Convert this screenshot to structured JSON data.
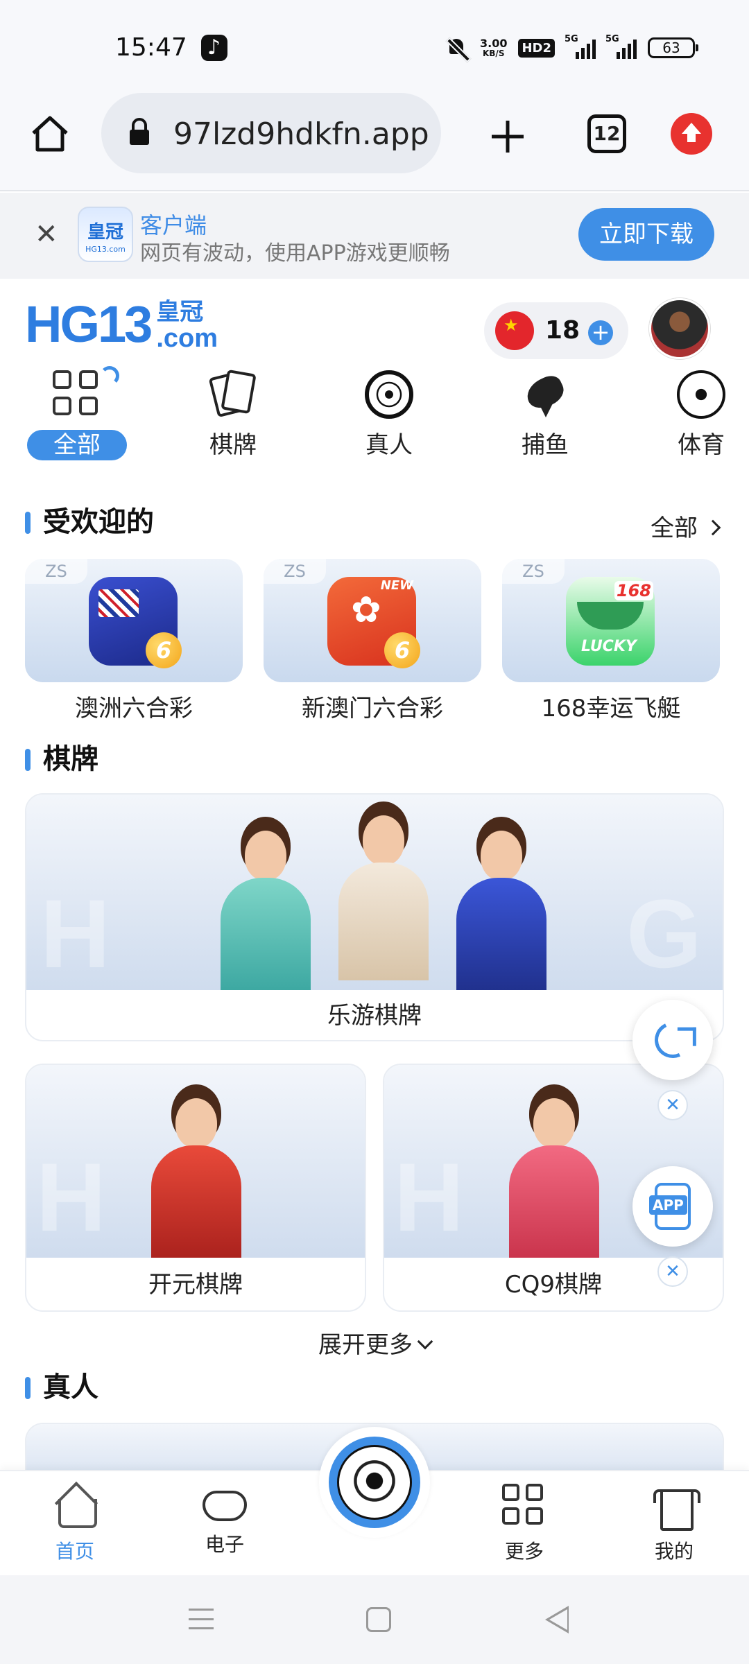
{
  "status_bar": {
    "time": "15:47",
    "net_speed_value": "3.00",
    "net_speed_unit": "KB/S",
    "hd_label": "HD2",
    "signal1_label": "5G",
    "signal2_label": "5G",
    "battery": "63"
  },
  "browser": {
    "url": "97lzd9hdkfn.app",
    "tab_count": "12"
  },
  "app_banner": {
    "logo_text": "皇冠",
    "logo_sub": "HG13.com",
    "title": "客户端",
    "subtitle": "网页有波动，使用APP游戏更顺畅",
    "download_label": "立即下载"
  },
  "header": {
    "logo_main": "HG13",
    "logo_cn": "皇冠",
    "logo_com": ".com",
    "balance": "18",
    "add_label": "+"
  },
  "categories": [
    {
      "label": "全部",
      "icon": "grid-icon",
      "active": true
    },
    {
      "label": "棋牌",
      "icon": "cards-icon"
    },
    {
      "label": "真人",
      "icon": "roulette-icon"
    },
    {
      "label": "捕鱼",
      "icon": "fish-icon"
    },
    {
      "label": "体育",
      "icon": "soccer-ball-icon"
    }
  ],
  "popular": {
    "title": "受欢迎的",
    "more_label": "全部",
    "items": [
      {
        "tag": "ZS",
        "name": "澳洲六合彩",
        "badge": "6"
      },
      {
        "tag": "ZS",
        "name": "新澳门六合彩",
        "badge": "6",
        "corner": "NEW"
      },
      {
        "tag": "ZS",
        "name": "168幸运飞艇",
        "corner": "168",
        "mark": "LUCKY"
      }
    ]
  },
  "chess": {
    "title": "棋牌",
    "featured": "乐游棋牌",
    "items": [
      "开元棋牌",
      "CQ9棋牌"
    ],
    "expand_label": "展开更多"
  },
  "live": {
    "title": "真人"
  },
  "floating": {
    "app_label": "APP",
    "close_label": "✕"
  },
  "bottom_nav": [
    {
      "label": "首页",
      "icon": "home-icon",
      "active": true
    },
    {
      "label": "电子",
      "icon": "gamepad-icon"
    },
    {
      "label": "",
      "icon": "soccer-ball-icon"
    },
    {
      "label": "更多",
      "icon": "grid-icon"
    },
    {
      "label": "我的",
      "icon": "shirt-icon"
    }
  ],
  "colors": {
    "accent": "#3f8fe6",
    "update_red": "#e8322f"
  }
}
